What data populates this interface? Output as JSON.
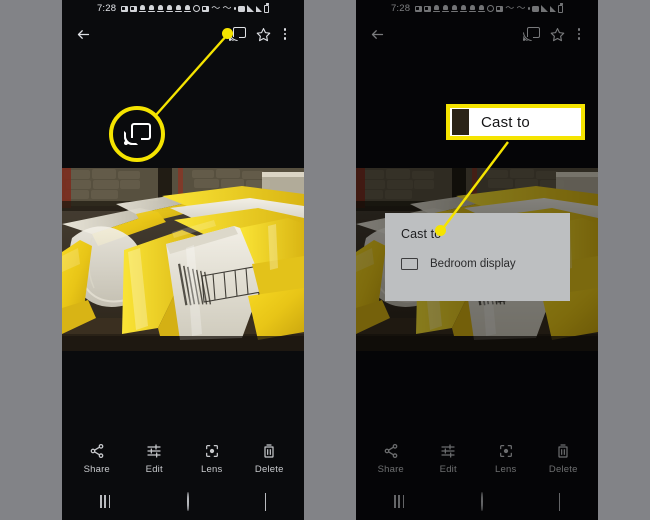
{
  "page": {
    "background_color": "#828387",
    "accent_color": "#f5e400",
    "phone_bg": "#0a0b0d"
  },
  "status_bar": {
    "time": "7:28",
    "icons": [
      "screenshot-icon",
      "video-icon",
      "bell-icon",
      "bell-icon",
      "bell-icon",
      "bell-icon",
      "bell-icon",
      "bell-icon",
      "clock-icon",
      "video-icon",
      "wave-icon",
      "wave-icon",
      "dot-icon",
      "camera-icon",
      "wifi-icon",
      "signal-icon",
      "battery-icon"
    ],
    "wave_glyph": "〜"
  },
  "app_bar": {
    "back_label": "Back",
    "back_icon": "arrow-left-icon",
    "cast_icon": "cast-icon",
    "favorite_icon": "star-outline-icon",
    "more_icon": "more-vertical-icon"
  },
  "photo": {
    "alt": "Warehouse pallets of yellow and white packaged bags"
  },
  "bottom_toolbar": {
    "items": [
      {
        "label": "Share",
        "icon": "share-icon"
      },
      {
        "label": "Edit",
        "icon": "sliders-icon"
      },
      {
        "label": "Lens",
        "icon": "lens-icon"
      },
      {
        "label": "Delete",
        "icon": "trash-icon"
      }
    ]
  },
  "nav_bar": {
    "recents_label": "Recents",
    "home_label": "Home",
    "back_label": "Back",
    "recents_icon": "recents-icon",
    "home_icon": "home-circle-icon",
    "back_icon": "chevron-left-icon"
  },
  "cast_dialog": {
    "title": "Cast to",
    "devices": [
      {
        "name": "Bedroom display",
        "icon": "monitor-icon"
      }
    ]
  },
  "annotations": {
    "left": {
      "type": "magnifier-circle",
      "target": "cast-icon",
      "color": "#f5e400"
    },
    "right": {
      "type": "callout-box",
      "text": "Cast to",
      "color": "#f5e400"
    }
  }
}
